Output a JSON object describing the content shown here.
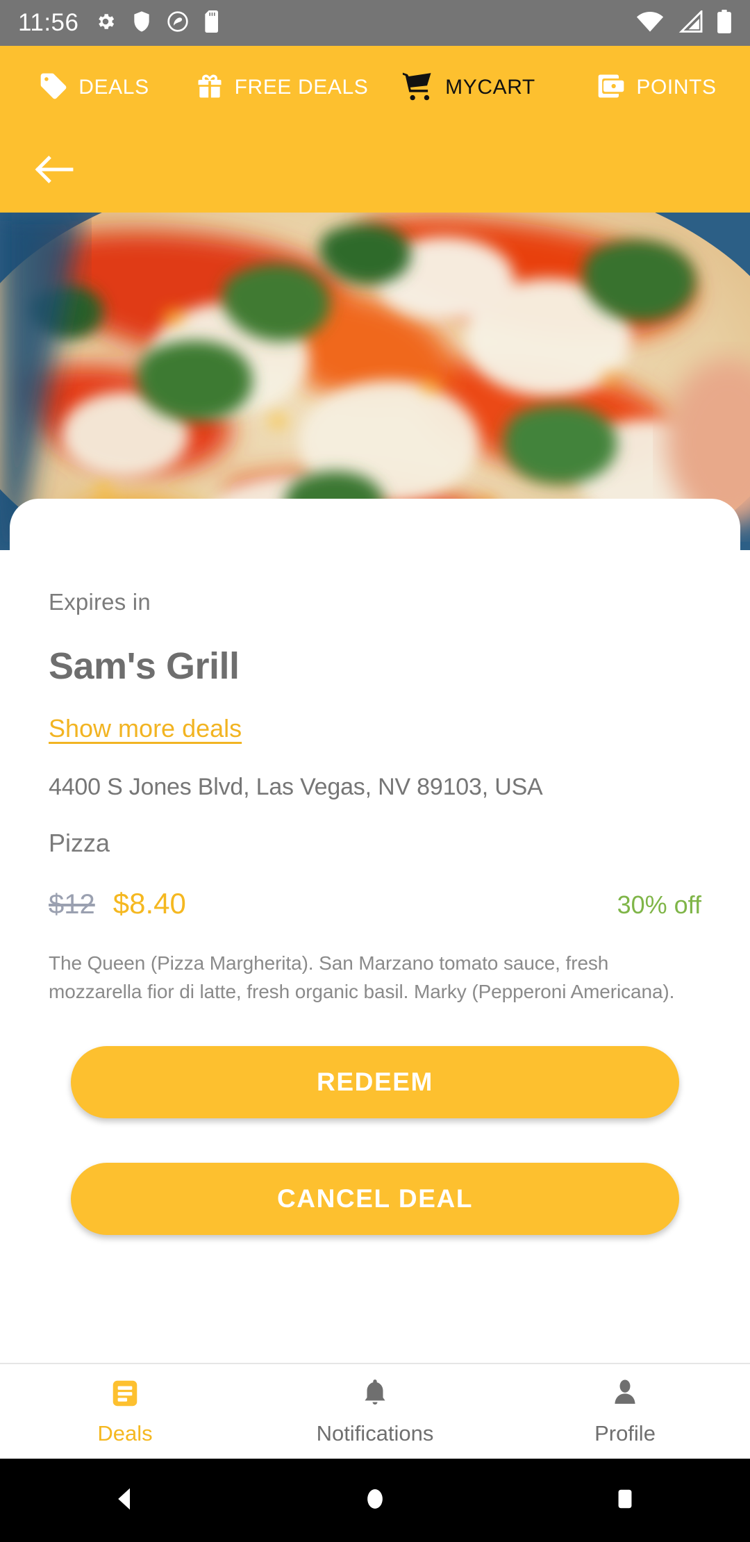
{
  "status_bar": {
    "time": "11:56",
    "left_icons": [
      "gear-icon",
      "shield-icon",
      "do-not-disturb-icon",
      "sd-card-icon"
    ],
    "right_icons": [
      "wifi-icon",
      "signal-icon",
      "battery-icon"
    ],
    "background": "#757575"
  },
  "top_tabs": {
    "items": [
      {
        "label": "DEALS",
        "icon": "tag-icon",
        "active": false
      },
      {
        "label": "FREE DEALS",
        "icon": "gift-icon",
        "active": false
      },
      {
        "label": "MYCART",
        "icon": "shopping-cart-icon",
        "active": true
      },
      {
        "label": "POINTS",
        "icon": "wallet-icon",
        "active": false
      }
    ],
    "background": "#FDC02F"
  },
  "sub_header": {
    "back_icon": "back-arrow-icon",
    "background": "#FDC02F"
  },
  "hero": {
    "alt": "margherita-pizza-photo"
  },
  "deal": {
    "expires_label": "Expires in",
    "expires_value": "",
    "store_name": "Sam's Grill",
    "more_deals_link": "Show more deals",
    "address": "4400 S Jones Blvd, Las Vegas, NV 89103, USA",
    "category": "Pizza",
    "price_original": "$12",
    "price_discounted": "$8.40",
    "discount_badge": "30% off",
    "description": "The Queen (Pizza Margherita). San Marzano tomato sauce, fresh mozzarella fior di latte, fresh organic basil. Marky (Pepperoni Americana).",
    "redeem_label": "REDEEM",
    "cancel_label": "CANCEL DEAL"
  },
  "colors": {
    "brand_yellow": "#FDC02F",
    "link_yellow": "#F2B422",
    "price_yellow": "#F5B820",
    "discount_green": "#7FB548",
    "muted_gray": "#7b7b7b",
    "strike_gray": "#9aa0b0"
  },
  "bottom_nav": {
    "items": [
      {
        "label": "Deals",
        "icon": "list-icon",
        "active": true
      },
      {
        "label": "Notifications",
        "icon": "bell-icon",
        "active": false
      },
      {
        "label": "Profile",
        "icon": "person-icon",
        "active": false
      }
    ]
  },
  "system_nav": {
    "items": [
      {
        "icon": "android-back-icon"
      },
      {
        "icon": "android-home-icon"
      },
      {
        "icon": "android-recents-icon"
      }
    ]
  }
}
